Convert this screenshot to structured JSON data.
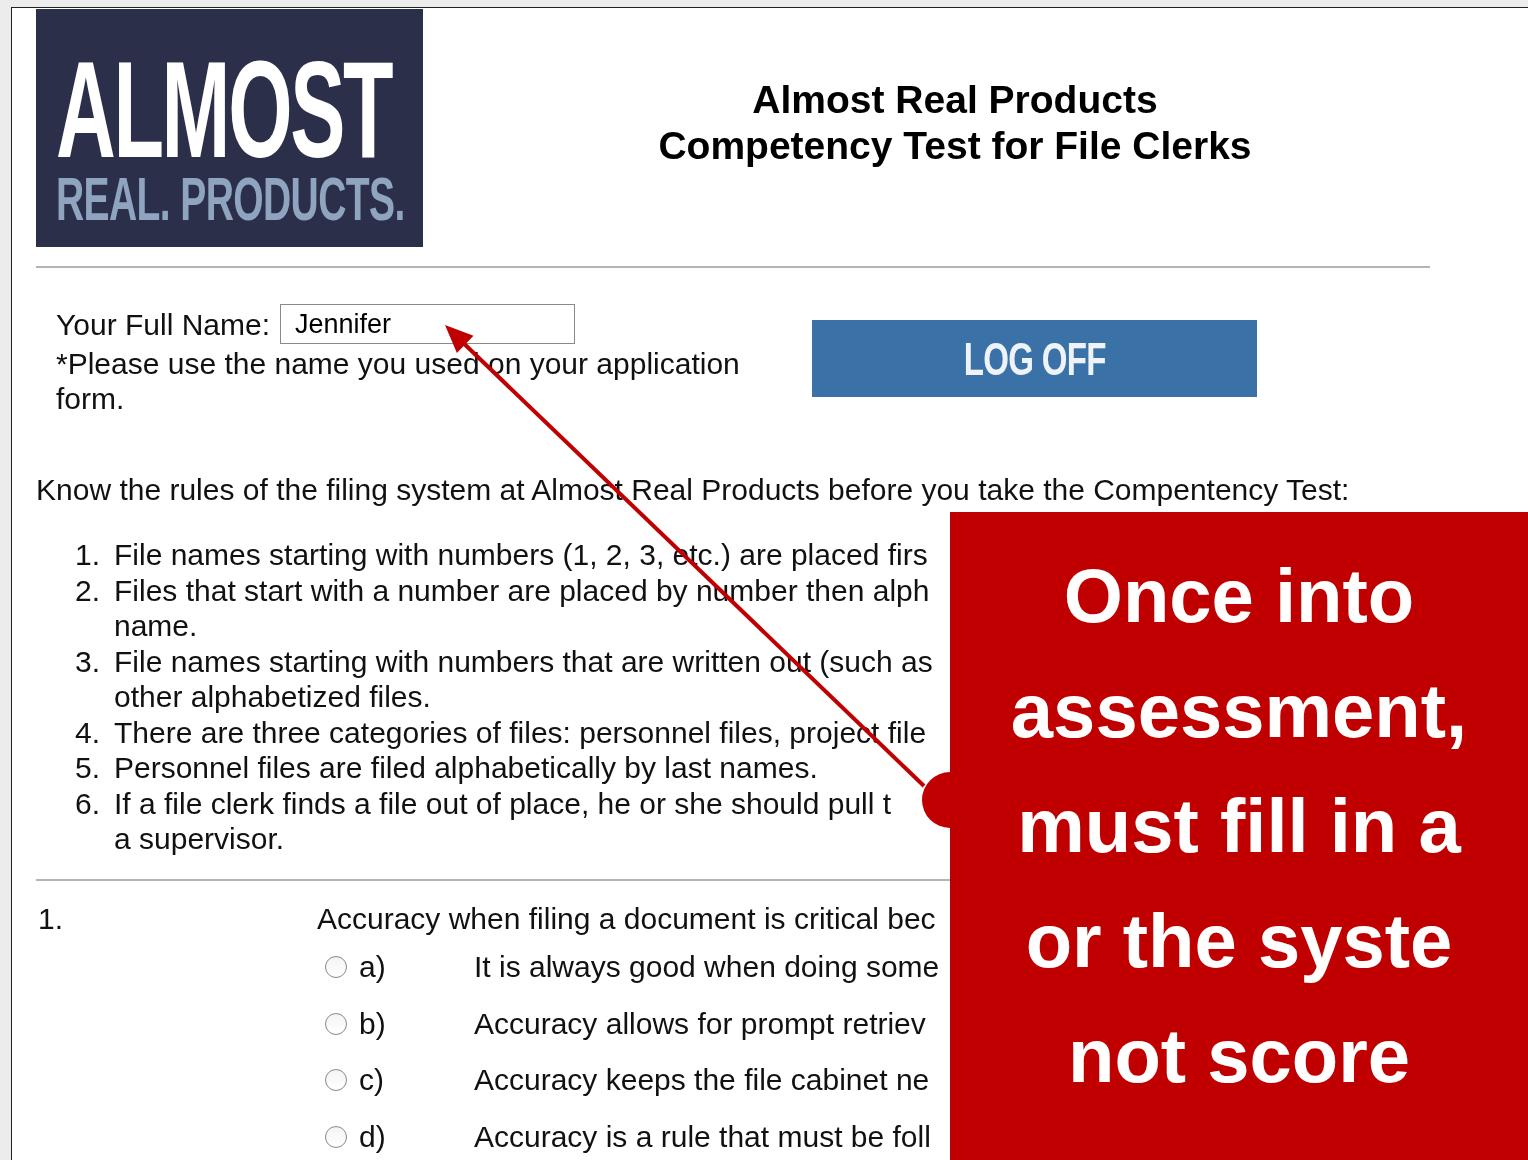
{
  "logo": {
    "line_1": "ALMOST",
    "line_2": "REAL. PRODUCTS."
  },
  "header": {
    "title": "Almost Real Products",
    "subtitle": "Competency Test for File Clerks"
  },
  "name_field": {
    "label": "Your Full Name:",
    "value": "Jennifer",
    "note": "*Please use the name you used on your application form."
  },
  "log_off_button": "LOG OFF",
  "rules": {
    "intro": "Know the rules of the filing system at Almost Real Products before you take the Compentency Test:",
    "items": [
      {
        "number": "1.",
        "lines": [
          "File names starting with numbers (1, 2, 3, etc.) are placed firs"
        ]
      },
      {
        "number": "2.",
        "lines": [
          "Files that start with a number are placed by number then alph",
          "name."
        ]
      },
      {
        "number": "3.",
        "lines": [
          "File names starting with numbers that are written out (such as",
          "other alphabetized files."
        ]
      },
      {
        "number": "4.",
        "lines": [
          "There are three categories of files: personnel files, project file"
        ]
      },
      {
        "number": "5.",
        "lines": [
          "Personnel files are filed alphabetically by last names."
        ]
      },
      {
        "number": "6.",
        "lines": [
          "If a file clerk finds a file out of place, he or she should pull t",
          "a supervisor."
        ]
      }
    ]
  },
  "question": {
    "number": "1.",
    "text": "Accuracy when filing a document is critical bec",
    "options": [
      {
        "letter": "a)",
        "text": "It is always good when doing some",
        "selected": false
      },
      {
        "letter": "b)",
        "text": "Accuracy allows for prompt retriev",
        "selected": false
      },
      {
        "letter": "c)",
        "text": "Accuracy keeps the file cabinet ne",
        "selected": false
      },
      {
        "letter": "d)",
        "text": "Accuracy is a rule that must be foll",
        "selected": false
      }
    ]
  },
  "callout": {
    "lines": [
      "Once into",
      "assessment,",
      "must fill in a",
      "or the syste",
      "not score"
    ]
  }
}
